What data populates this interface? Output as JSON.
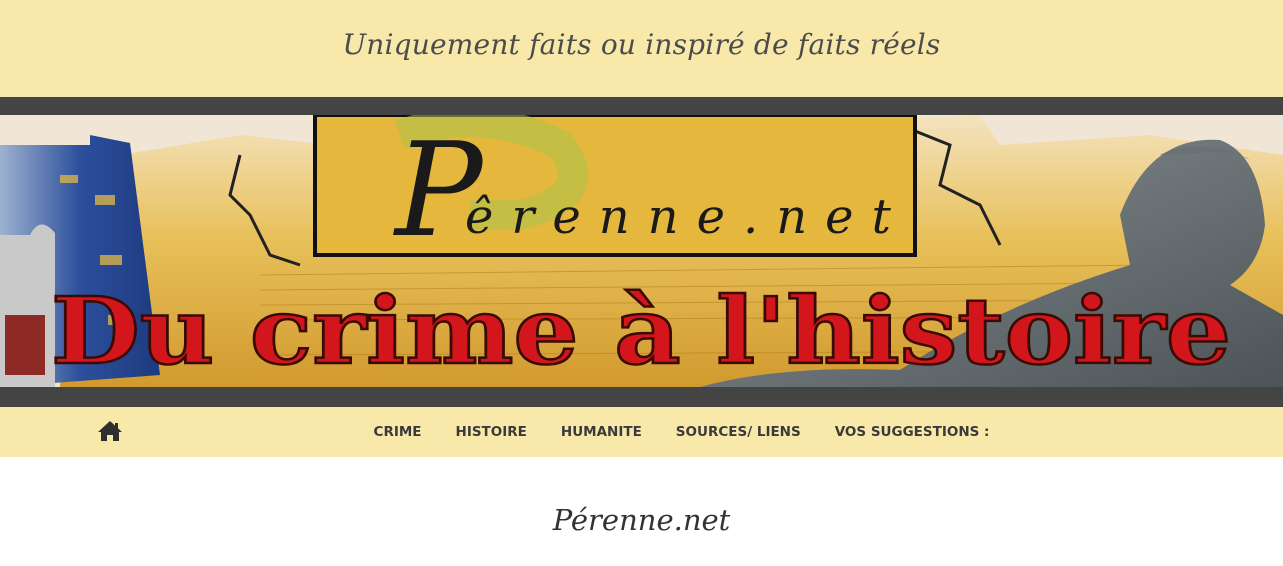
{
  "header": {
    "tagline": "Uniquement faits ou inspiré de faits réels"
  },
  "banner": {
    "logo_text": "Pêrenne.net",
    "headline": "Du crime à l'histoire",
    "colors": {
      "frame": "#444444",
      "headline_red": "#d3161c",
      "logo_box": "#e6b93c",
      "parchment": "#e9c46a"
    }
  },
  "nav": {
    "home_icon": "home-icon",
    "items": [
      {
        "label": "CRIME"
      },
      {
        "label": "HISTOIRE"
      },
      {
        "label": "HUMANITE"
      },
      {
        "label": "SOURCES/ LIENS"
      },
      {
        "label": "VOS SUGGESTIONS :"
      }
    ]
  },
  "main": {
    "title": "Pérenne.net"
  },
  "theme": {
    "bar_background": "#f8e9aa",
    "text_dark": "#3a3a3a"
  }
}
